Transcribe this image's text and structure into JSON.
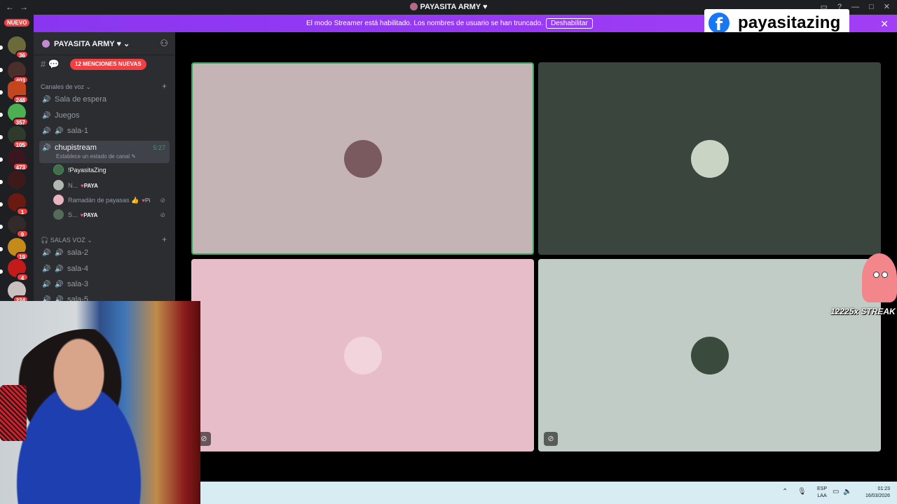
{
  "window": {
    "title": "PAYASITA ARMY",
    "nav_back": "←",
    "nav_forward": "→"
  },
  "banner": {
    "text": "El modo Streamer está habilitado. Los nombres de usuario se han truncado.",
    "button": "Deshabilitar",
    "close": "✕"
  },
  "overlay": {
    "facebook_handle": "payasitazing",
    "streak": "12225x STREAK"
  },
  "guilds": {
    "nuevo": "NUEVO",
    "badges": [
      "36",
      "403",
      "248",
      "357",
      "105",
      "473",
      "1",
      "9",
      "19",
      "4",
      "224"
    ]
  },
  "server": {
    "name": "PAYASITA ARMY",
    "mentions_badge": "12 MENCIONES NUEVAS",
    "voice_category": "Canales de voz",
    "channels": [
      "Sala de espera",
      "Juegos",
      "sala-1"
    ],
    "active_channel": {
      "name": "chupistream",
      "time": "5:27",
      "status": "Establece un estado de canal"
    },
    "users": [
      {
        "name": "!PayasitaZing",
        "tag": ""
      },
      {
        "name": "N...",
        "tag": "PAYA"
      },
      {
        "name": "Ramadán de payasas",
        "tag": "Pi"
      },
      {
        "name": "S...",
        "tag": "PAYA"
      }
    ],
    "salas_category": "SALAS VOZ",
    "salas": [
      "sala-2",
      "sala-4",
      "sala-3",
      "sala-5"
    ]
  },
  "tiles": [
    {
      "color": "#c5b4b6",
      "avatar_color": "#7a5a5e",
      "speaking": true,
      "muted": false
    },
    {
      "color": "#39453d",
      "avatar_color": "#c9d4c4",
      "speaking": false,
      "muted": false
    },
    {
      "color": "#e7bdc9",
      "avatar_color": "#f2d4dc",
      "speaking": false,
      "muted": true
    },
    {
      "color": "#c1ccc6",
      "avatar_color": "#3a4a3c",
      "speaking": false,
      "muted": true
    }
  ],
  "taskbar": {
    "lang_1": "ESP",
    "lang_2": "LAA",
    "time": "01:23",
    "date": "16/03/2026"
  },
  "colors": {
    "accent": "#a23ef5",
    "danger": "#f23f42",
    "online": "#23a55a",
    "sidebar": "#2b2d31"
  }
}
